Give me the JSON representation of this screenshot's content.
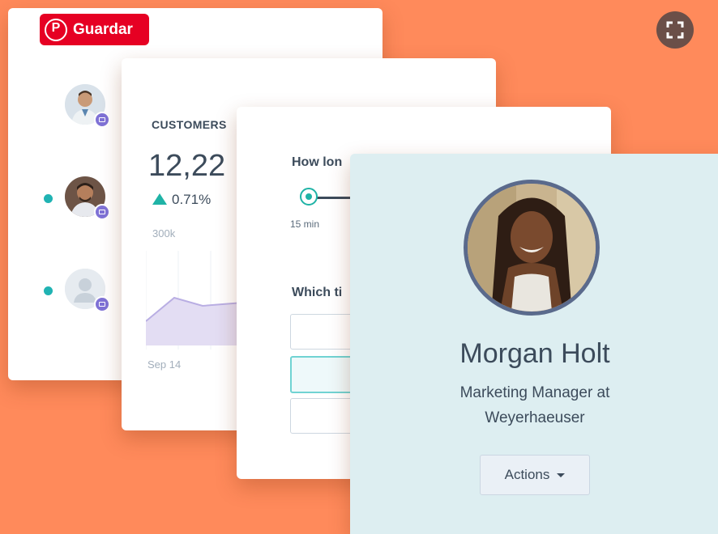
{
  "pin_save": {
    "label": "Guardar",
    "icon": "pinterest-icon",
    "color": "#e60023"
  },
  "expand": {
    "icon": "expand-icon"
  },
  "contacts_card": {
    "contacts": [
      {
        "status_dot": false,
        "avatar": "person-photo"
      },
      {
        "status_dot": true,
        "avatar": "person-photo"
      },
      {
        "status_dot": true,
        "avatar": "placeholder-person-icon"
      }
    ]
  },
  "stats_card": {
    "label": "CUSTOMERS",
    "value": "12,22",
    "change": "0.71%",
    "axis_label": "300k",
    "date_label": "Sep 14",
    "accent": "#1fb3a6"
  },
  "form_card": {
    "question1": "How lon",
    "slider_value": "15 min",
    "question2": "Which ti"
  },
  "profile_card": {
    "name": "Morgan Holt",
    "role_line1": "Marketing Manager at",
    "role_line2": "Weyerhaeuser",
    "actions_label": "Actions"
  }
}
